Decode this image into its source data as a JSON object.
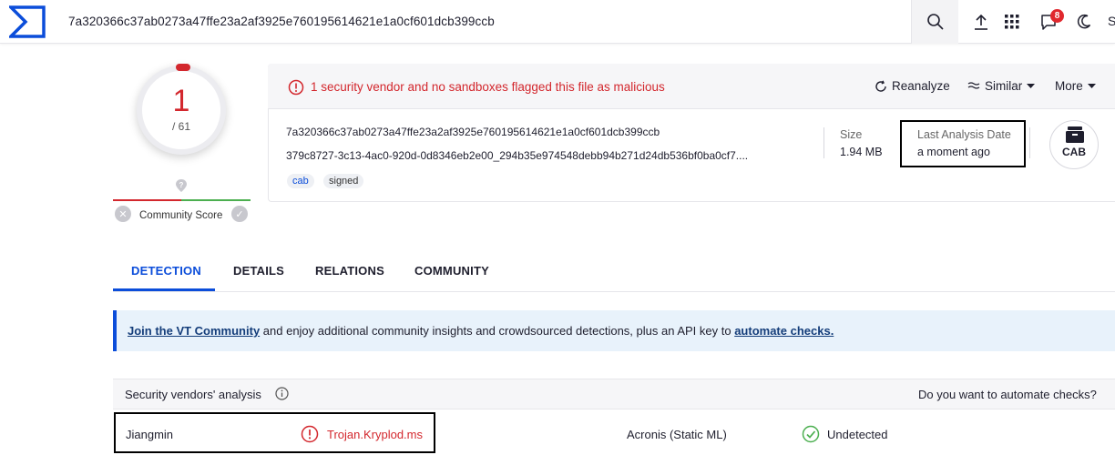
{
  "topbar": {
    "search_value": "7a320366c37ab0273a47ffe23a2af3925e760195614621e1a0cf601dcb399ccb",
    "notification_count": "8",
    "clipped_letter": "S",
    "icons": [
      "virustotal-logo-icon",
      "search-icon",
      "upload-icon",
      "apps-grid-icon",
      "notifications-icon",
      "dark-mode-icon"
    ]
  },
  "score": {
    "detections": "1",
    "total": "/ 61",
    "community_label": "Community Score"
  },
  "summary": {
    "alert": "1 security vendor and no sandboxes flagged this file as malicious",
    "actions": {
      "reanalyze": "Reanalyze",
      "similar": "Similar",
      "more": "More"
    },
    "sha256": "7a320366c37ab0273a47ffe23a2af3925e760195614621e1a0cf601dcb399ccb",
    "file_name": "379c8727-3c13-4ac0-920d-0d8346eb2e00_294b35e974548debb94b271d24db536bf0ba0cf7....",
    "tags": [
      "cab",
      "signed"
    ],
    "size_label": "Size",
    "size_value": "1.94 MB",
    "date_label": "Last Analysis Date",
    "date_value": "a moment ago",
    "file_type": "CAB"
  },
  "tabs": [
    {
      "label": "DETECTION",
      "active": true
    },
    {
      "label": "DETAILS",
      "active": false
    },
    {
      "label": "RELATIONS",
      "active": false
    },
    {
      "label": "COMMUNITY",
      "active": false
    }
  ],
  "banner": {
    "link1": "Join the VT Community",
    "middle": " and enjoy additional community insights and crowdsourced detections, plus an API key to ",
    "link2": "automate checks."
  },
  "vendors": {
    "title": "Security vendors' analysis",
    "automate_prompt": "Do you want to automate checks?",
    "rows": [
      {
        "left_vendor": "Jiangmin",
        "left_result": "Trojan.Kryplod.ms",
        "left_status": "malicious",
        "right_vendor": "Acronis (Static ML)",
        "right_result": "Undetected",
        "right_status": "undetected"
      }
    ]
  },
  "colors": {
    "accent": "#0b4dda",
    "malicious": "#d3272d",
    "undetected": "#4caf50"
  }
}
